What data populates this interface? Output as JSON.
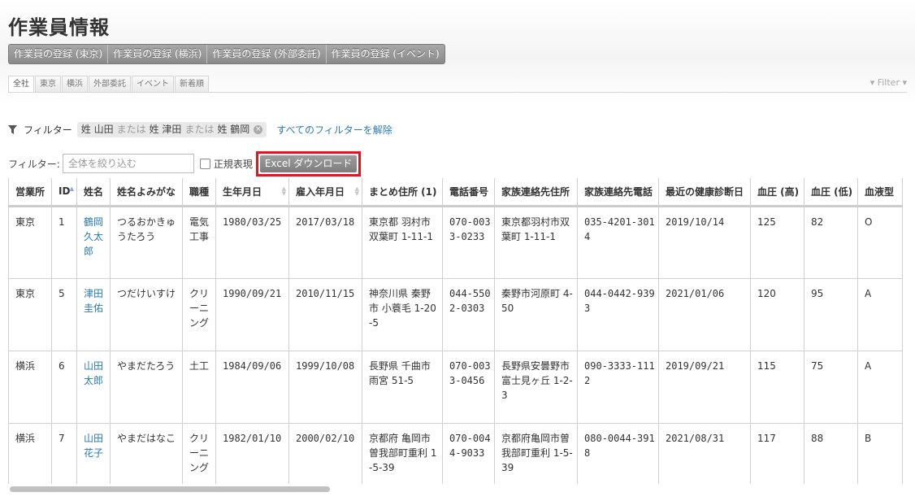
{
  "page": {
    "title": "作業員情報"
  },
  "register_buttons": [
    "作業員の登録 (東京)",
    "作業員の登録 (横浜)",
    "作業員の登録 (外部委託)",
    "作業員の登録 (イベント)"
  ],
  "tabs": [
    {
      "label": "全社",
      "active": true
    },
    {
      "label": "東京",
      "active": false
    },
    {
      "label": "横浜",
      "active": false
    },
    {
      "label": "外部委託",
      "active": false
    },
    {
      "label": "イベント",
      "active": false
    },
    {
      "label": "新着順",
      "active": false
    }
  ],
  "filter_toggle": "Filter",
  "active_filter": {
    "label": "フィルター",
    "chip": {
      "t1": "姓 山田",
      "or1": "または",
      "t2": "姓 津田",
      "or2": "または",
      "t3": "姓 鶴岡"
    },
    "clear": "すべてのフィルターを解除"
  },
  "search": {
    "label": "フィルター:",
    "placeholder": "全体を絞り込む",
    "value": "",
    "regex_label": "正規表現",
    "regex_checked": false,
    "excel_label": "Excel ダウンロード"
  },
  "table": {
    "headers": [
      "営業所",
      "ID",
      "姓名",
      "姓名よみがな",
      "職種",
      "生年月日",
      "雇入年月日",
      "まとめ住所 (1)",
      "電話番号",
      "家族連絡先住所",
      "家族連絡先電話",
      "最近の健康診断日",
      "血圧 (高)",
      "血圧 (低)",
      "血液型"
    ],
    "rows": [
      [
        "東京",
        "1",
        "鶴岡久太郎",
        "つるおかきゅうたろう",
        "電気工事",
        "1980/03/25",
        "2017/03/18",
        "東京都 羽村市 双葉町 1-11-1",
        "070-0033-0233",
        "東京都羽村市双葉町 1-11-1",
        "035-4201-3014",
        "2019/10/14",
        "125",
        "82",
        "O"
      ],
      [
        "東京",
        "5",
        "津田圭佑",
        "つだけいすけ",
        "クリーニング",
        "1990/09/21",
        "2010/11/15",
        "神奈川県 秦野市 小蓑毛 1-20-5",
        "044-5502-0303",
        "秦野市河原町 4-50",
        "044-0442-9393",
        "2021/01/06",
        "120",
        "95",
        "A"
      ],
      [
        "横浜",
        "6",
        "山田太郎",
        "やまだたろう",
        "土工",
        "1984/09/06",
        "1999/10/08",
        "長野県 千曲市 雨宮 51-5",
        "070-0033-0456",
        "長野県安曇野市富士見ヶ丘 1-2-3",
        "090-3333-1112",
        "2019/09/21",
        "115",
        "75",
        "A"
      ],
      [
        "横浜",
        "7",
        "山田花子",
        "やまだはなこ",
        "クリーニング",
        "1982/01/10",
        "2000/02/10",
        "京都府 亀岡市 曽我部町重利 1-5-39",
        "070-0044-9033",
        "京都府亀岡市曽我部町重利 1-5-39",
        "080-0044-3918",
        "2021/08/31",
        "117",
        "88",
        "B"
      ]
    ]
  }
}
